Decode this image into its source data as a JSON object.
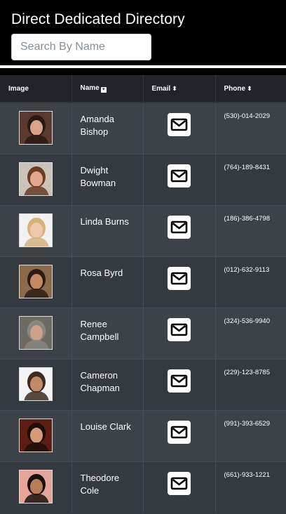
{
  "header": {
    "title": "Direct Dedicated Directory",
    "search_placeholder": "Search By Name"
  },
  "table": {
    "columns": [
      {
        "label": "Image",
        "sort_icon": ""
      },
      {
        "label": "Name",
        "sort_icon": "sort-down-square-icon"
      },
      {
        "label": "Email",
        "sort_icon": "sort-icon"
      },
      {
        "label": "Phone",
        "sort_icon": "sort-icon"
      }
    ],
    "rows": [
      {
        "name": "Amanda Bishop",
        "phone": "(530)-014-2029",
        "avatar": {
          "bg": "#5a3a2e",
          "skin": "#d9a48a",
          "hair": "#2a1a14"
        }
      },
      {
        "name": "Dwight Bowman",
        "phone": "(764)-189-8431",
        "avatar": {
          "bg": "#c9c3bb",
          "skin": "#e0a98d",
          "hair": "#6b3b22"
        }
      },
      {
        "name": "Linda Burns",
        "phone": "(186)-386-4798",
        "avatar": {
          "bg": "#f1f1f1",
          "skin": "#f0c6ad",
          "hair": "#d6b27a"
        }
      },
      {
        "name": "Rosa Byrd",
        "phone": "(012)-632-9113",
        "avatar": {
          "bg": "#8b6a4a",
          "skin": "#c48a62",
          "hair": "#2b1c12"
        }
      },
      {
        "name": "Renee Campbell",
        "phone": "(324)-536-9940",
        "avatar": {
          "bg": "#6d6a64",
          "skin": "#caa38a",
          "hair": "#8a8680"
        }
      },
      {
        "name": "Cameron Chapman",
        "phone": "(229)-123-8785",
        "avatar": {
          "bg": "#f4f4f4",
          "skin": "#c08a66",
          "hair": "#3a2a22"
        }
      },
      {
        "name": "Louise Clark",
        "phone": "(991)-393-6529",
        "avatar": {
          "bg": "#5a1e12",
          "skin": "#d69a78",
          "hair": "#1e0e08"
        }
      },
      {
        "name": "Theodore Cole",
        "phone": "(661)-933-1221",
        "avatar": {
          "bg": "#e6a59a",
          "skin": "#b97c5a",
          "hair": "#1a1010"
        }
      }
    ]
  }
}
